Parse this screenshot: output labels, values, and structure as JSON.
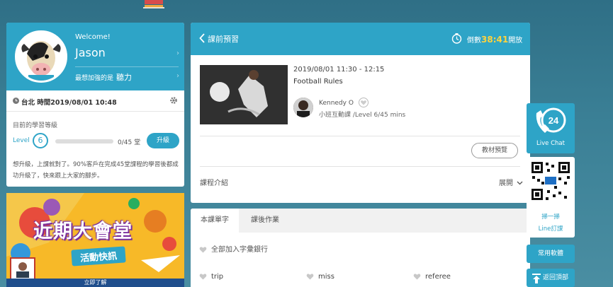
{
  "profile": {
    "welcome": "Welcome!",
    "username": "Jason",
    "favorite_label": "最想加強的是",
    "favorite_value": "聽力",
    "timezone": "台北 時間2019/08/01 10:48",
    "level_title": "目前的學習等級",
    "level_label": "Level",
    "level_number": "6",
    "progress_text": "0/45 堂",
    "progress_fraction": 0,
    "upgrade_label": "升級",
    "promo_text": "想升級，上課就對了。90%客戶在完成45堂課程的學習後都成功升級了，快來跟上大家的腳步。"
  },
  "banner": {
    "title": "近期大會堂",
    "subtitle": "活動快訊",
    "footer": "立即了解"
  },
  "course": {
    "back_label": "課前預習",
    "countdown_prefix": "倒數",
    "countdown_min": "38",
    "countdown_sep": ":",
    "countdown_sec": "41",
    "countdown_suffix": "開放",
    "date": "2019/08/01 11:30 - 12:15",
    "title": "Football Rules",
    "teacher": "Kennedy O",
    "info": "小班互動課 /Level 6/45 mins",
    "preview_button": "教材預覽",
    "intro_label": "課程介紹",
    "expand_label": "展開"
  },
  "vocab": {
    "tabs": [
      "本課單字",
      "課後作業"
    ],
    "add_all": "全部加入字彙銀行",
    "words": [
      "trip",
      "miss",
      "referee"
    ]
  },
  "sidebar_widgets": {
    "live_chat_number": "24",
    "live_chat_label": "Live Chat",
    "qr_line1": "掃一掃",
    "qr_line2": "Line訂課",
    "software_label": "常用軟體",
    "top_label": "返回頂部"
  },
  "colors": {
    "accent": "#2ea4c7",
    "countdown_highlight": "#ffd33d"
  }
}
